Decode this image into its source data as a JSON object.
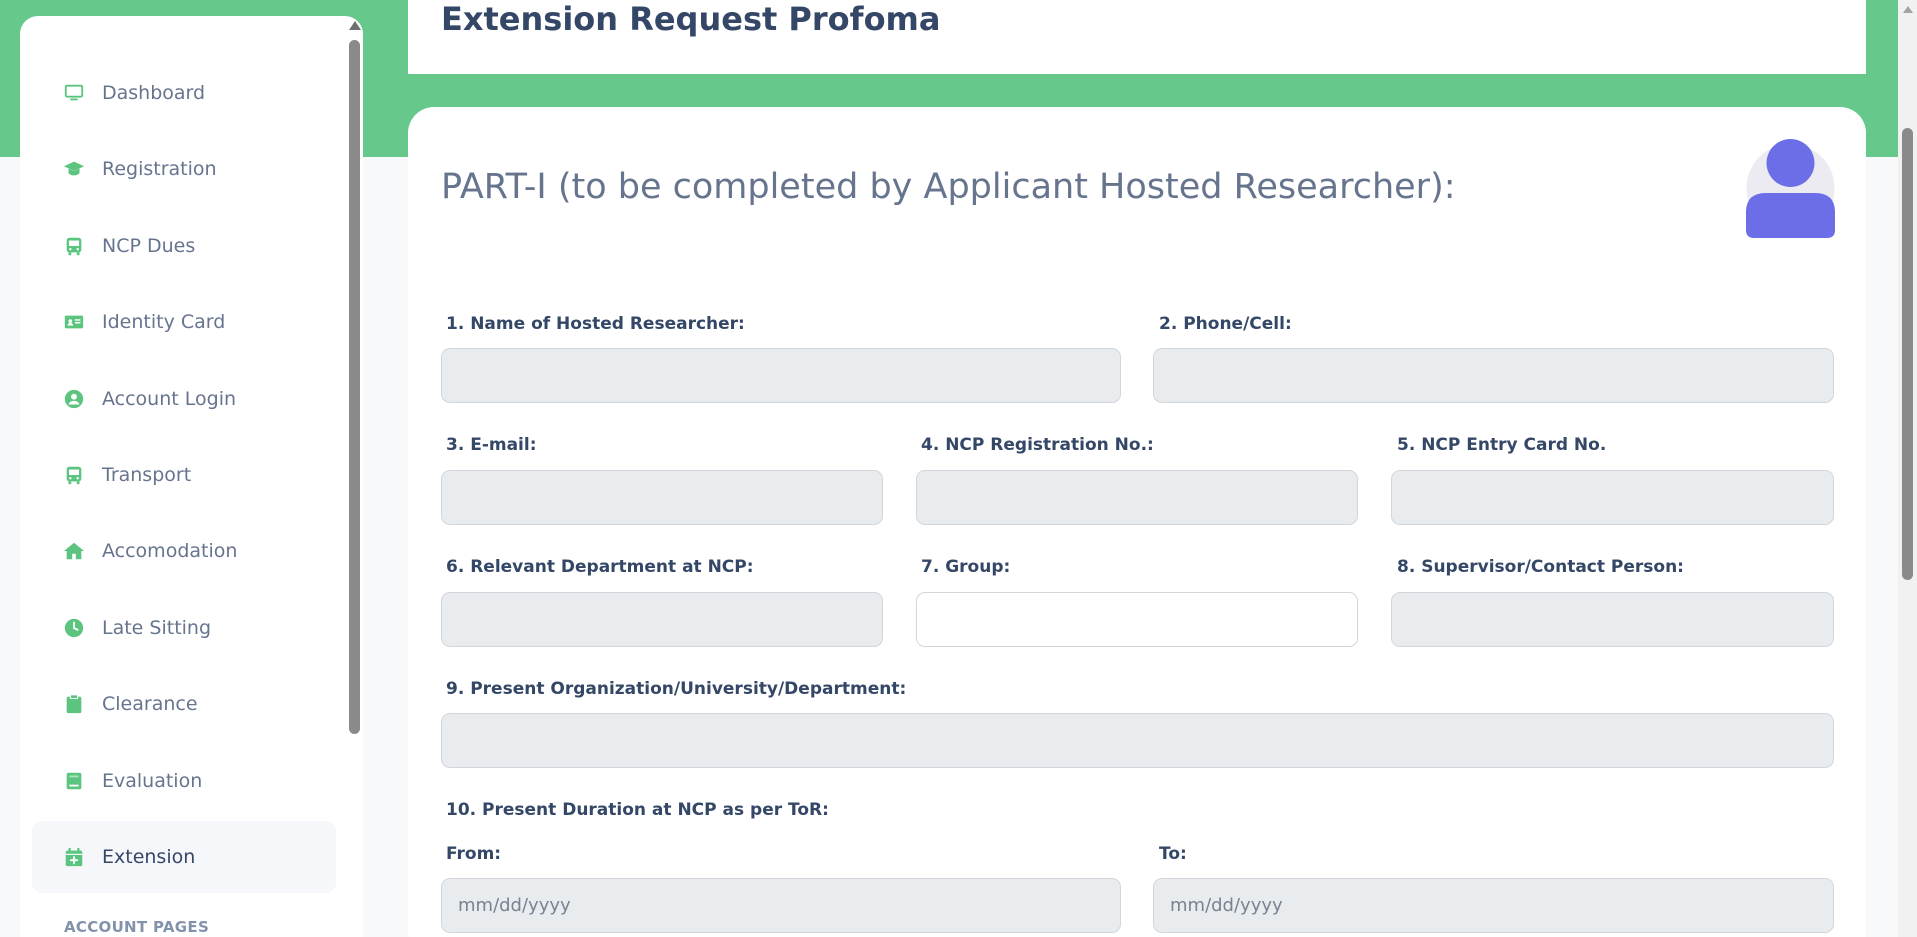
{
  "theme": {
    "accent": "#66c98b",
    "icon_green": "#5bc57f",
    "avatar": "#6c6ee8"
  },
  "sidebar": {
    "items": [
      {
        "label": "Dashboard",
        "icon": "monitor-icon"
      },
      {
        "label": "Registration",
        "icon": "graduation-cap-icon"
      },
      {
        "label": "NCP Dues",
        "icon": "bus-icon"
      },
      {
        "label": "Identity Card",
        "icon": "id-card-icon"
      },
      {
        "label": "Account Login",
        "icon": "user-circle-icon"
      },
      {
        "label": "Transport",
        "icon": "bus-icon"
      },
      {
        "label": "Accomodation",
        "icon": "home-icon"
      },
      {
        "label": "Late Sitting",
        "icon": "clock-icon"
      },
      {
        "label": "Clearance",
        "icon": "clipboard-icon"
      },
      {
        "label": "Evaluation",
        "icon": "book-icon"
      },
      {
        "label": "Extension",
        "icon": "calendar-plus-icon",
        "active": true
      }
    ],
    "section_heading": "ACCOUNT PAGES"
  },
  "header": {
    "title": "Extension Request Profoma"
  },
  "form": {
    "part_title": "PART-I (to be completed by Applicant Hosted Researcher):",
    "labels": {
      "name": "1. Name of Hosted Researcher:",
      "phone": "2. Phone/Cell:",
      "email": "3. E-mail:",
      "reg_no": "4. NCP Registration No.:",
      "entry_card": "5. NCP Entry Card No.",
      "department": "6. Relevant Department at NCP:",
      "group": "7. Group:",
      "supervisor": "8. Supervisor/Contact Person:",
      "organization": "9. Present Organization/University/Department:",
      "duration": "10. Present Duration at NCP as per ToR:",
      "from": "From:",
      "to": "To:"
    },
    "values": {
      "name": "",
      "phone": "",
      "email": "",
      "reg_no": "",
      "entry_card": "",
      "department": "",
      "group": "",
      "supervisor": "",
      "organization": ""
    },
    "date_placeholder": "mm/dd/yyyy"
  }
}
